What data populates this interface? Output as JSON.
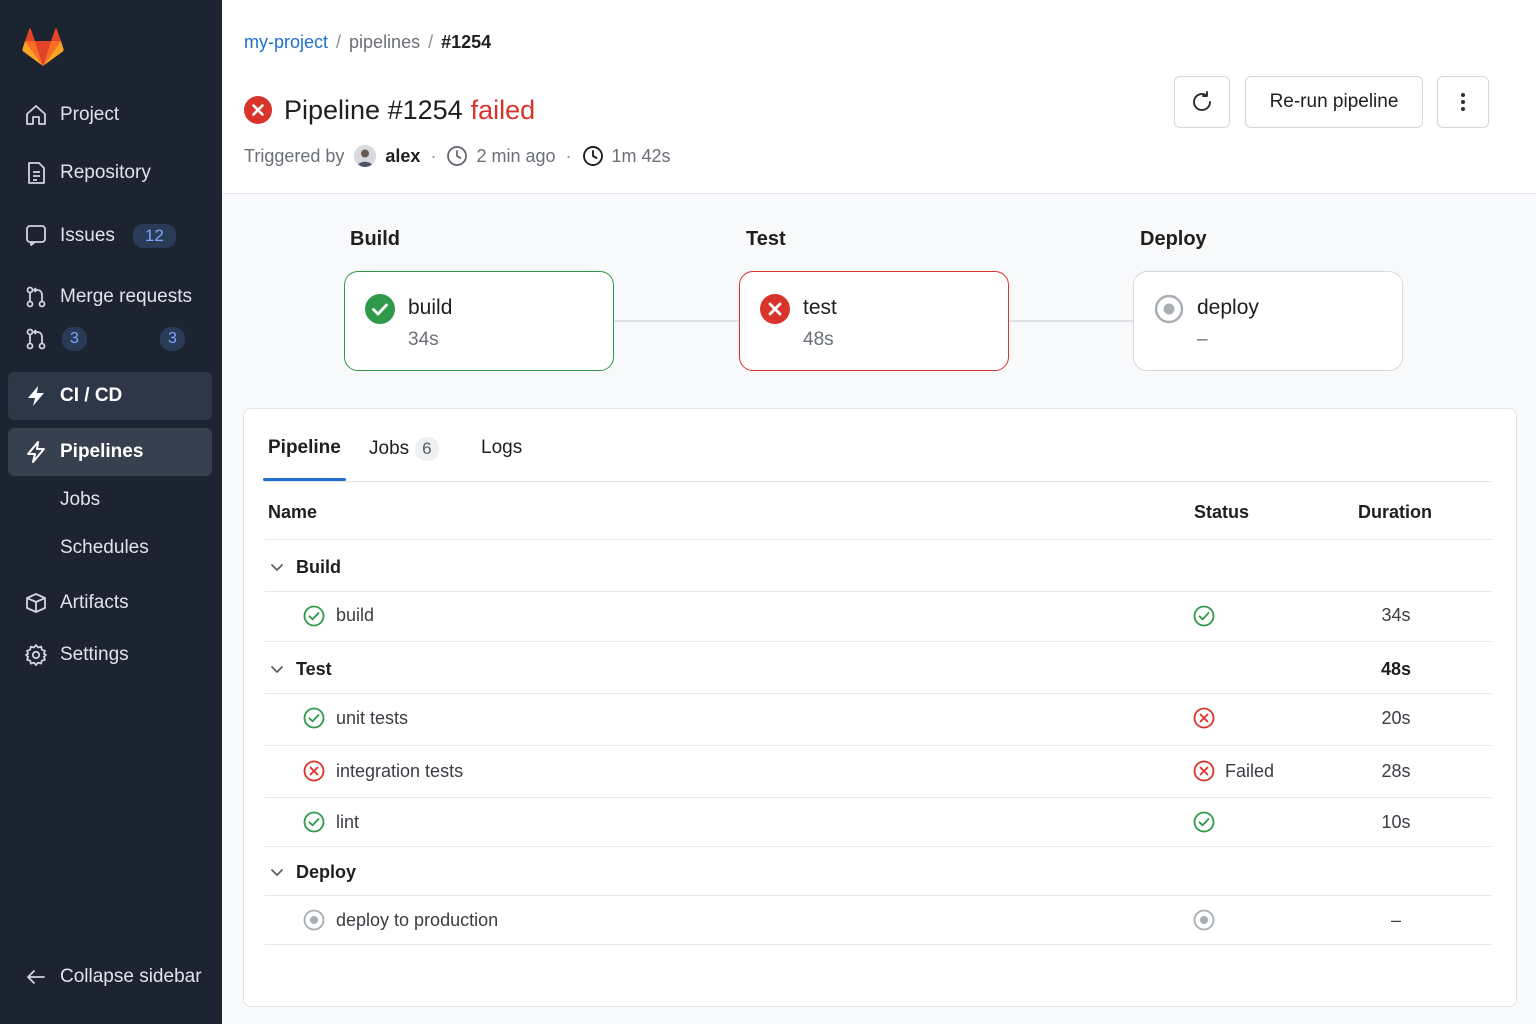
{
  "colors": {
    "sidebar_bg": "#1c2432",
    "accent": "#1f6fd1",
    "success": "#2f9a4a",
    "failed": "#d9342b",
    "skipped": "#9aa0a6"
  },
  "sidebar": {
    "project": "Project",
    "repository": "Repository",
    "issues": "Issues",
    "issues_count": "12",
    "merge_requests": "Merge requests",
    "mr_badge_left": "3",
    "mr_badge_right": "3",
    "cicd": "CI / CD",
    "pipelines": "Pipelines",
    "jobs": "Jobs",
    "schedules": "Schedules",
    "artifacts": "Artifacts",
    "settings": "Settings",
    "collapse": "Collapse sidebar"
  },
  "breadcrumb": {
    "project": "my-project",
    "section": "pipelines",
    "current": "#1254",
    "separator": "/"
  },
  "header": {
    "title": "Pipeline #1254",
    "status": "failed",
    "triggered_by": "Triggered by",
    "user": "alex",
    "time_ago": "2 min ago",
    "duration": "1m 42s",
    "meta_separator": "·",
    "rerun_label": "Re-run pipeline"
  },
  "graph": {
    "stages": [
      {
        "label": "Build",
        "job": "build",
        "duration": "34s",
        "status": "success"
      },
      {
        "label": "Test",
        "job": "test",
        "duration": "48s",
        "status": "failed"
      },
      {
        "label": "Deploy",
        "job": "deploy",
        "duration": "–",
        "status": "skipped"
      }
    ]
  },
  "tabs": {
    "pipeline": "Pipeline",
    "jobs": "Jobs",
    "jobs_count": "6",
    "logs": "Logs"
  },
  "table": {
    "col_name": "Name",
    "col_status": "Status",
    "col_duration": "Duration",
    "groups": [
      {
        "name": "Build",
        "duration": "",
        "jobs": [
          {
            "name": "build",
            "status": "success",
            "status_text": "",
            "duration": "34s"
          }
        ]
      },
      {
        "name": "Test",
        "duration": "48s",
        "jobs": [
          {
            "name": "unit tests",
            "status": "success",
            "row_status": "failed",
            "status_text": "",
            "duration": "20s"
          },
          {
            "name": "integration tests",
            "status": "failed",
            "row_status": "failed",
            "status_text": "Failed",
            "duration": "28s"
          },
          {
            "name": "lint",
            "status": "success",
            "row_status": "success",
            "status_text": "",
            "duration": "10s"
          }
        ]
      },
      {
        "name": "Deploy",
        "duration": "",
        "jobs": [
          {
            "name": "deploy to production",
            "status": "skipped",
            "row_status": "skipped",
            "status_text": "",
            "duration": "–"
          }
        ]
      }
    ]
  }
}
